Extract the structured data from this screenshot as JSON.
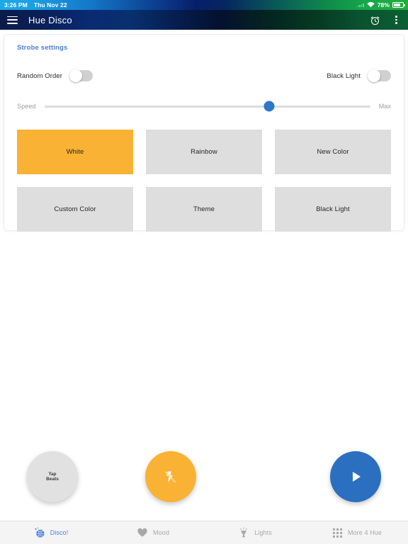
{
  "status_bar": {
    "time": "3:26 PM",
    "date": "Thu Nov 22",
    "battery_percent": "78%",
    "wifi_icon": "wifi-icon",
    "battery_icon": "battery-icon"
  },
  "app_bar": {
    "menu_icon": "hamburger-menu-icon",
    "title": "Hue Disco",
    "timer_icon": "alarm-timer-icon",
    "overflow_icon": "overflow-menu-icon"
  },
  "card": {
    "title": "Strobe settings",
    "toggles": [
      {
        "label": "Random Order",
        "value": "off"
      },
      {
        "label": "Black Light",
        "value": "off"
      }
    ],
    "slider": {
      "min_label": "Speed",
      "max_label": "Max",
      "percent": 69
    },
    "modes": [
      {
        "label": "White",
        "selected": true
      },
      {
        "label": "Rainbow",
        "selected": false
      },
      {
        "label": "New Color",
        "selected": false
      },
      {
        "label": "Custom Color",
        "selected": false
      },
      {
        "label": "Theme",
        "selected": false
      },
      {
        "label": "Black Light",
        "selected": false
      }
    ]
  },
  "fabs": {
    "tap_beats_line1": "Tap",
    "tap_beats_line2": "Beats",
    "strobe_icon": "flash-off-icon",
    "play_icon": "play-icon"
  },
  "bottom_nav": {
    "items": [
      {
        "label": "Disco!",
        "icon": "disco-ball-icon",
        "active": true
      },
      {
        "label": "Mood",
        "icon": "heart-icon",
        "active": false
      },
      {
        "label": "Lights",
        "icon": "lamp-icon",
        "active": false
      },
      {
        "label": "More 4 Hue",
        "icon": "grid-icon",
        "active": false
      }
    ]
  },
  "colors": {
    "accent_blue": "#2b6fc0",
    "accent_amber": "#f9b233",
    "link_blue": "#4a7fd4",
    "button_gray": "#dedede"
  }
}
